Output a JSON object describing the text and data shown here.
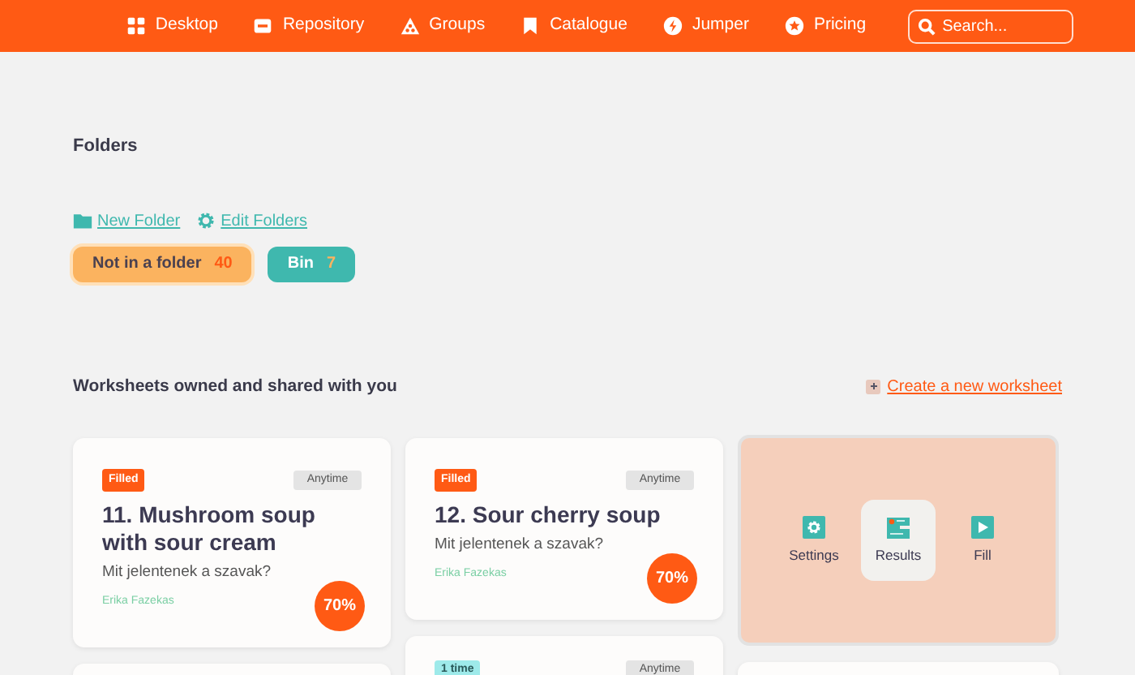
{
  "nav": {
    "items": [
      {
        "kind": "grid",
        "label": "Desktop"
      },
      {
        "kind": "card",
        "label": "Repository"
      },
      {
        "kind": "group",
        "label": "Groups"
      },
      {
        "kind": "bookmark",
        "label": "Catalogue"
      },
      {
        "kind": "bolt",
        "label": "Jumper"
      },
      {
        "kind": "star",
        "label": "Pricing"
      }
    ],
    "search": {
      "placeholder": "Search..."
    }
  },
  "folders": {
    "title": "Folders",
    "links": [
      {
        "kind": "folder",
        "label": "New Folder"
      },
      {
        "kind": "gear",
        "label": "Edit Folders"
      }
    ],
    "chips": [
      {
        "label": "Not in a folder",
        "count": "40",
        "selected": true
      },
      {
        "label": "Bin",
        "count": "7",
        "selected": false
      }
    ]
  },
  "worksheets": {
    "title": "Worksheets owned and shared with you",
    "create_link": "Create a new worksheet",
    "columns": [
      [
        {
          "kind": "worksheet",
          "badge": {
            "kind": "filled",
            "label": "Filled"
          },
          "timing": "Anytime",
          "title": "11. Mushroom soup with sour cream",
          "subtitle": "Mit jelentenek a szavak?",
          "author": "Erika Fazekas",
          "score": "70%"
        },
        {
          "kind": "blank"
        }
      ],
      [
        {
          "kind": "worksheet",
          "badge": {
            "kind": "filled",
            "label": "Filled"
          },
          "timing": "Anytime",
          "title": "12. Sour cherry soup",
          "subtitle": "Mit jelentenek a szavak?",
          "author": "Erika Fazekas",
          "score": "70%"
        },
        {
          "kind": "stub",
          "badge": {
            "kind": "once",
            "label": "1 time"
          },
          "timing": "Anytime"
        }
      ],
      [
        {
          "kind": "actions",
          "actions": [
            {
              "kind": "gear",
              "label": "Settings",
              "selected": false
            },
            {
              "kind": "results",
              "label": "Results",
              "selected": true
            },
            {
              "kind": "play",
              "label": "Fill",
              "selected": false
            }
          ]
        },
        {
          "kind": "blank"
        }
      ]
    ]
  }
}
